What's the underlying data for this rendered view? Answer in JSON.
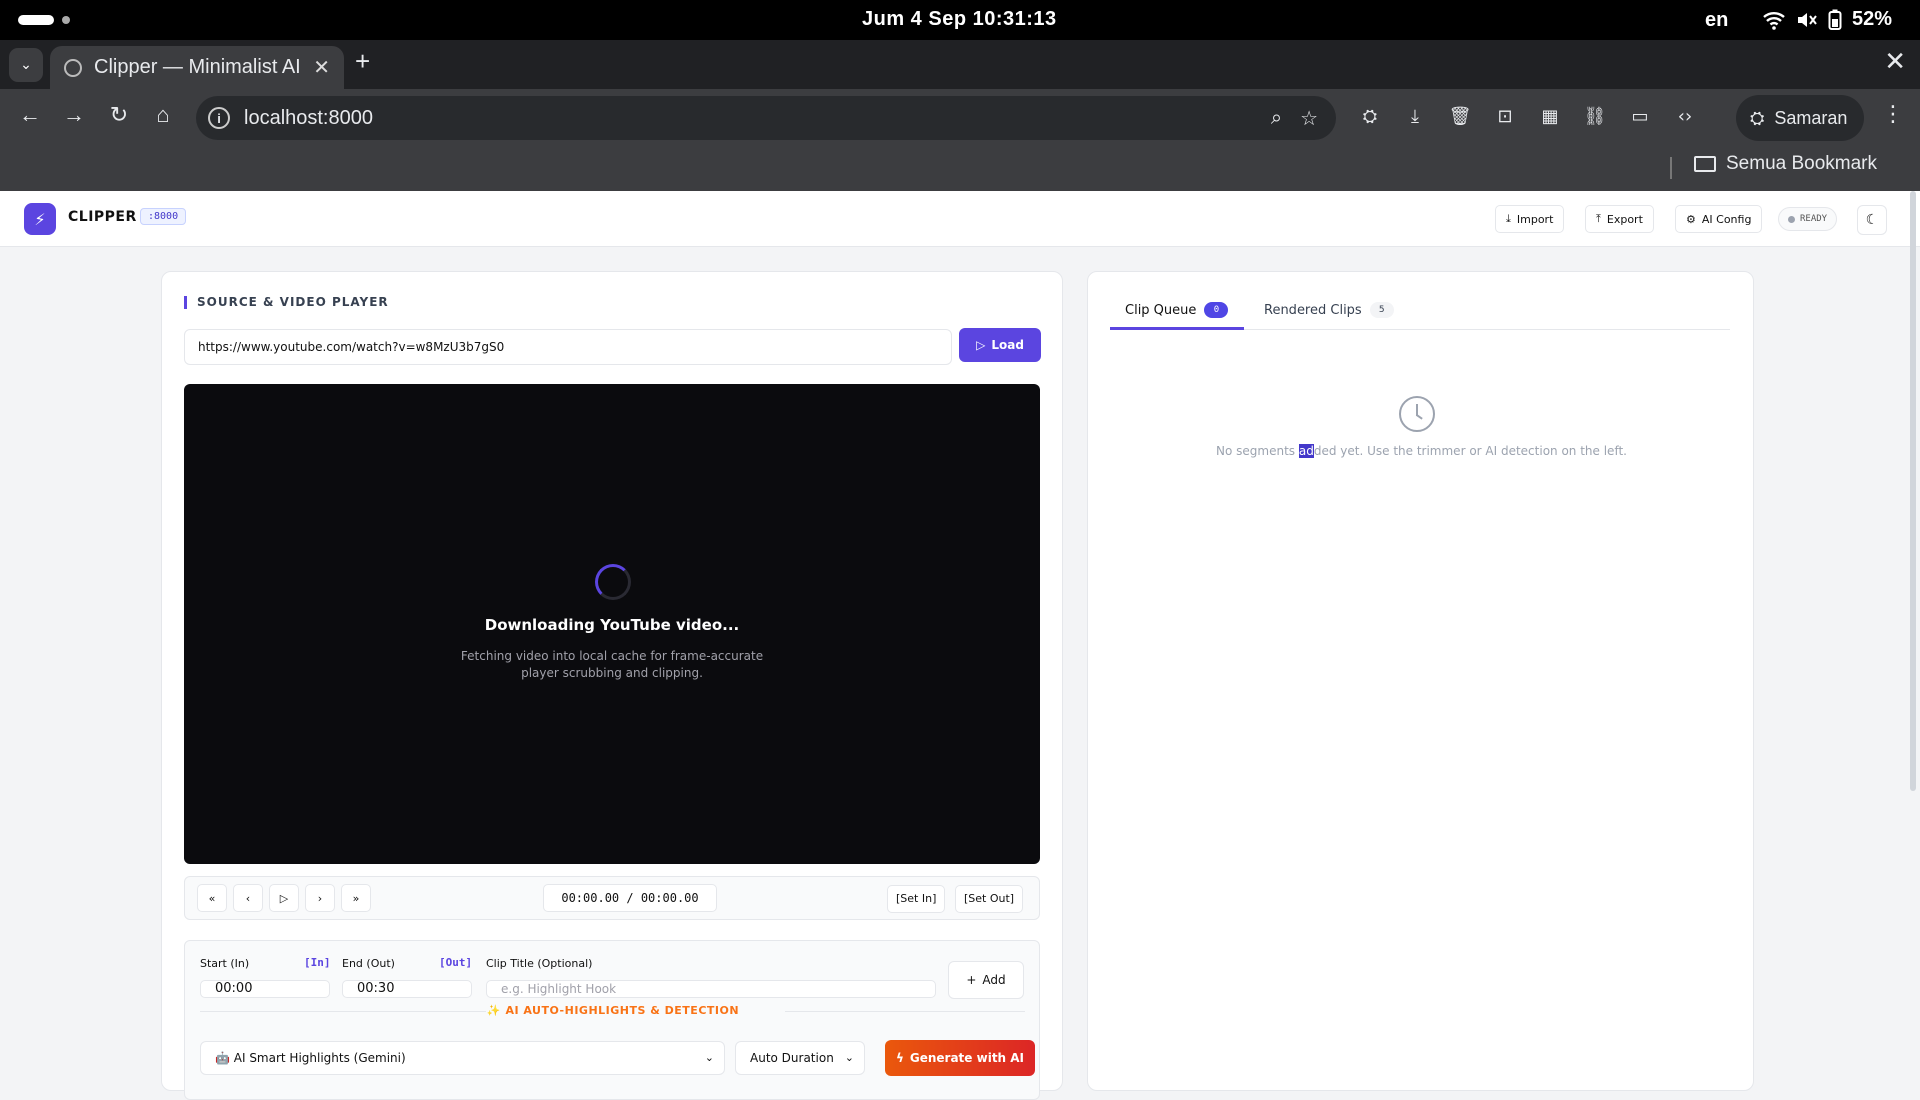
{
  "statusbar": {
    "date": "Jum   4 Sep  10:31:13",
    "lang": "en",
    "battery": "52%"
  },
  "browser": {
    "tab_title": "Clipper — Minimalist AI Video",
    "tab_close": "✕",
    "new_tab": "+",
    "window_close": "✕",
    "url": "localhost:8000",
    "profile": "Samaran",
    "bookmarks_label": "Semua Bookmark"
  },
  "app": {
    "brand": "CLIPPER",
    "port": ":8000",
    "header_buttons": {
      "import": "Import",
      "export": "Export",
      "ai_config": "AI Config"
    },
    "status": "READY"
  },
  "left_panel": {
    "section_title": "SOURCE & VIDEO PLAYER",
    "url_value": "https://www.youtube.com/watch?v=w8MzU3b7gS0",
    "load_label": "Load",
    "video": {
      "title": "Downloading YouTube video...",
      "subtitle": "Fetching video into local cache for frame-accurate player scrubbing and clipping."
    },
    "controls": {
      "timecode": "00:00.00 / 00:00.00",
      "set_in": "[Set In]",
      "set_out": "[Set Out]"
    },
    "trimmer": {
      "start_label": "Start (In)",
      "in_tag": "[In]",
      "start_value": "00:00",
      "end_label": "End (Out)",
      "out_tag": "[Out]",
      "end_value": "00:30",
      "title_label": "Clip Title (Optional)",
      "title_placeholder": "e.g. Highlight Hook",
      "add_label": "Add",
      "ai_title": "✨ AI AUTO-HIGHLIGHTS & DETECTION",
      "mode_value": "🤖 AI Smart Highlights (Gemini)",
      "duration_value": "Auto Duration",
      "generate_label": "Generate with AI"
    }
  },
  "right_panel": {
    "tabs": [
      {
        "label": "Clip Queue",
        "count": "0"
      },
      {
        "label": "Rendered Clips",
        "count": "5"
      }
    ],
    "empty_before": "No segments ",
    "empty_highlight": "ad",
    "empty_after": "ded yet. Use the trimmer or AI detection on the left."
  },
  "colors": {
    "accent": "#5b45e0",
    "ai": "#f97316",
    "generate": "#ea580c"
  }
}
